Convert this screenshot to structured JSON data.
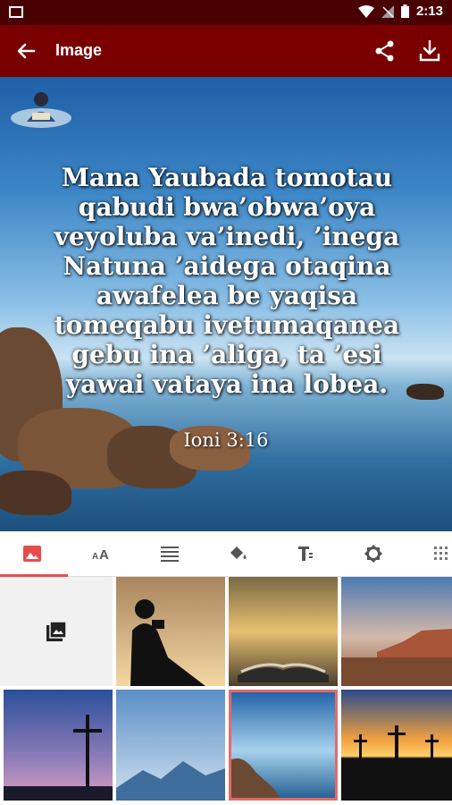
{
  "status_bar": {
    "time": "2:13"
  },
  "app_bar": {
    "title": "Image"
  },
  "verse": {
    "lines": [
      "Mana Yaubada tomotau",
      "qabudi bwa’obwa’oya",
      "veyoluba va’inedi, ’inega",
      "Natuna ’aidega otaqina",
      "awafelea be yaqisa",
      "tomeqabu ivetumaqanea",
      "gebu ina ’aliga, ta ’esi",
      "yawai vataya ina lobea."
    ],
    "reference": "Ioni 3:16"
  },
  "tabs": [
    {
      "icon": "image-icon",
      "active": true
    },
    {
      "icon": "text-size-icon",
      "active": false
    },
    {
      "icon": "align-icon",
      "active": false
    },
    {
      "icon": "fill-color-icon",
      "active": false
    },
    {
      "icon": "text-format-icon",
      "active": false
    },
    {
      "icon": "brightness-icon",
      "active": false
    },
    {
      "icon": "grid-icon",
      "active": false
    }
  ],
  "backgrounds": [
    {
      "name": "gallery-picker"
    },
    {
      "name": "person-reading-silhouette"
    },
    {
      "name": "open-bible-sunset"
    },
    {
      "name": "desert-mountain-dusk"
    },
    {
      "name": "cross-silhouette-dusk"
    },
    {
      "name": "misty-mountains-blue"
    },
    {
      "name": "rocky-shore-sea",
      "selected": true
    },
    {
      "name": "three-crosses-sunset"
    }
  ]
}
